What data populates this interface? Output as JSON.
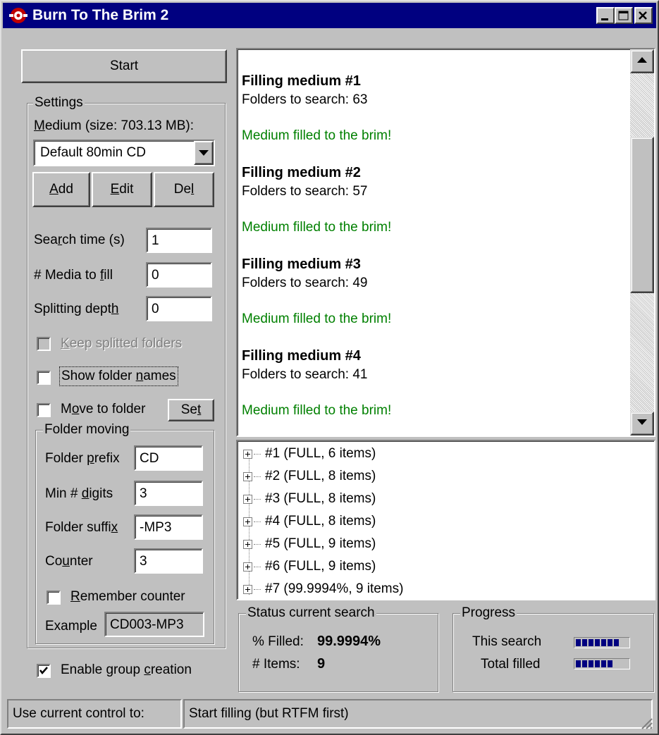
{
  "window": {
    "title": "Burn To The Brim 2"
  },
  "start_button": "Start",
  "settings": {
    "group_title": "Settings",
    "medium_label_pre": "M",
    "medium_label_rest": "edium (size: 703.13 MB):",
    "medium_selected": "Default 80min CD",
    "add_pre": "A",
    "add_rest": "dd",
    "edit_pre": "E",
    "edit_rest": "dit",
    "del_pre": "De",
    "del_u": "l",
    "search_time": {
      "pre": "Sea",
      "u": "r",
      "post": "ch time (s)",
      "value": "1"
    },
    "media_to_fill": {
      "pre": "# Media to ",
      "u": "f",
      "post": "ill",
      "value": "0"
    },
    "splitting_depth": {
      "pre": "Splitting dept",
      "u": "h",
      "post": "",
      "value": "0"
    },
    "keep_splitted": {
      "u": "K",
      "post": "eep splitted folders"
    },
    "show_names": {
      "pre": "Show folder ",
      "u": "n",
      "post": "ames"
    },
    "move_to_folder": {
      "pre": "M",
      "u": "o",
      "post": "ve to folder"
    },
    "set_button": {
      "pre": "Se",
      "u": "t"
    },
    "enable_group": {
      "pre": "Enable group ",
      "u": "c",
      "post": "reation"
    }
  },
  "folder_moving": {
    "group_title": "Folder moving",
    "prefix": {
      "pre": "Folder ",
      "u": "p",
      "post": "refix",
      "value": "CD"
    },
    "digits": {
      "pre": "Min # ",
      "u": "d",
      "post": "igits",
      "value": "3"
    },
    "suffix": {
      "pre": "Folder suffi",
      "u": "x",
      "post": "",
      "value": "-MP3"
    },
    "counter": {
      "pre": "Co",
      "u": "u",
      "post": "nter",
      "value": "3"
    },
    "remember": {
      "u": "R",
      "post": "emember counter"
    },
    "example_label": "Example",
    "example_value": "CD003-MP3"
  },
  "log": [
    {
      "heading": "Filling medium #1",
      "detail": "Folders to search: 63",
      "result": "Medium filled to the brim!"
    },
    {
      "heading": "Filling medium #2",
      "detail": "Folders to search: 57",
      "result": "Medium filled to the brim!"
    },
    {
      "heading": "Filling medium #3",
      "detail": "Folders to search: 49",
      "result": "Medium filled to the brim!"
    },
    {
      "heading": "Filling medium #4",
      "detail": "Folders to search: 41",
      "result": "Medium filled to the brim!"
    }
  ],
  "tree": [
    "#1 (FULL, 6 items)",
    "#2 (FULL, 8 items)",
    "#3 (FULL, 8 items)",
    "#4 (FULL, 8 items)",
    "#5 (FULL, 9 items)",
    "#6 (FULL, 9 items)",
    "#7 (99.9994%, 9 items)"
  ],
  "status": {
    "group_title": "Status current search",
    "filled_label": "% Filled:",
    "filled_value": "99.9994%",
    "items_label": "# Items:",
    "items_value": "9"
  },
  "progress": {
    "group_title": "Progress",
    "this_search_label": "This search",
    "this_search_level": 1.0,
    "total_label": "Total filled",
    "total_level": 0.86
  },
  "statusbar": {
    "left": "Use current control to:",
    "right": "Start filling (but RTFM first)"
  },
  "colors": {
    "title_bg": "#000080",
    "face": "#c0c0c0",
    "log_green": "#008000",
    "progress": "#000080"
  }
}
